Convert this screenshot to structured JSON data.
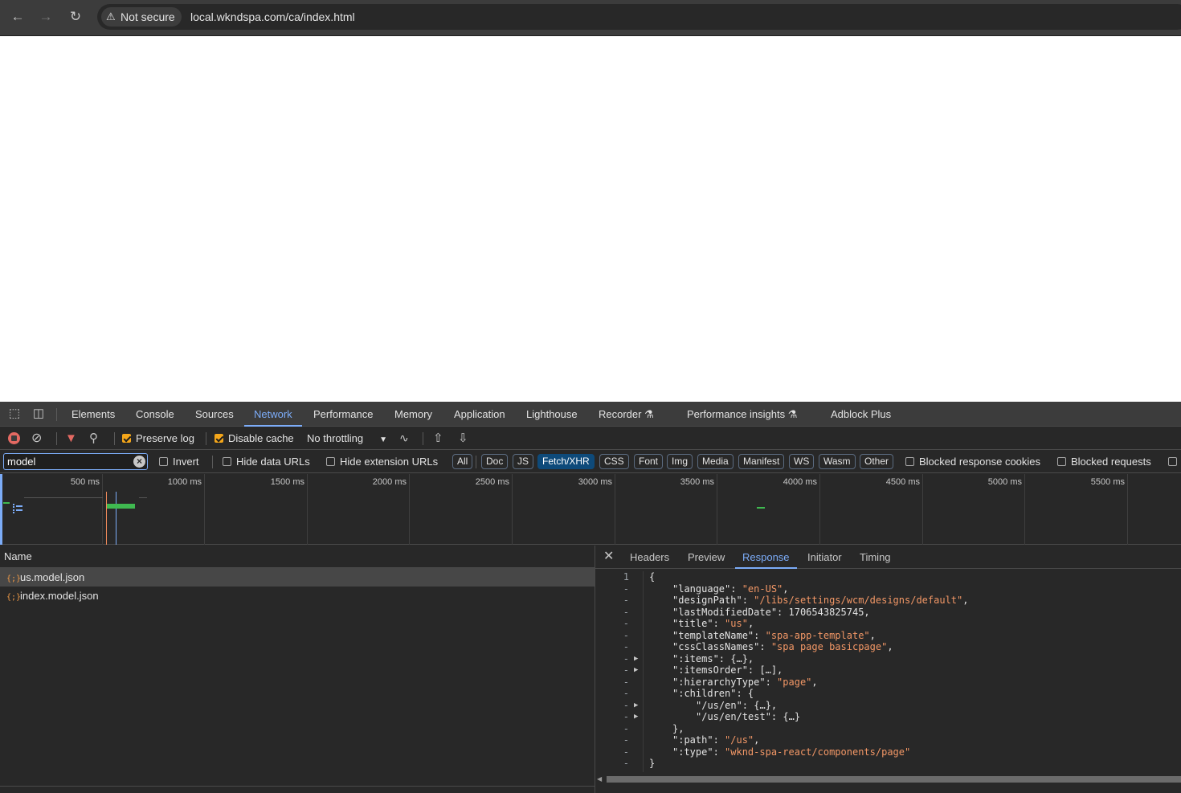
{
  "browser": {
    "back_icon": "arrow-left-icon",
    "forward_icon": "arrow-right-icon",
    "reload_icon": "reload-icon",
    "security_label": "Not secure",
    "url": "local.wkndspa.com/ca/index.html"
  },
  "devtools": {
    "tabs": [
      "Elements",
      "Console",
      "Sources",
      "Network",
      "Performance",
      "Memory",
      "Application",
      "Lighthouse",
      "Recorder",
      "Performance insights",
      "Adblock Plus"
    ],
    "active_tab": "Network",
    "toolbar": {
      "preserve_log": "Preserve log",
      "preserve_log_checked": true,
      "disable_cache": "Disable cache",
      "disable_cache_checked": true,
      "throttling": "No throttling"
    },
    "filter": {
      "value": "model",
      "invert": "Invert",
      "hide_data_urls": "Hide data URLs",
      "hide_extension_urls": "Hide extension URLs",
      "types": [
        "All",
        "Doc",
        "JS",
        "Fetch/XHR",
        "CSS",
        "Font",
        "Img",
        "Media",
        "Manifest",
        "WS",
        "Wasm",
        "Other"
      ],
      "active_type": "Fetch/XHR",
      "blocked_cookies": "Blocked response cookies",
      "blocked_requests": "Blocked requests"
    },
    "timeline": {
      "ticks": [
        "500 ms",
        "1000 ms",
        "1500 ms",
        "2000 ms",
        "2500 ms",
        "3000 ms",
        "3500 ms",
        "4000 ms",
        "4500 ms",
        "5000 ms",
        "5500 ms"
      ]
    },
    "requests": {
      "column_name": "Name",
      "items": [
        "us.model.json",
        "index.model.json"
      ],
      "selected": "us.model.json"
    },
    "details": {
      "tabs": [
        "Headers",
        "Preview",
        "Response",
        "Initiator",
        "Timing"
      ],
      "active_tab": "Response",
      "lines": [
        {
          "no": "1",
          "arrow": false,
          "indent": 0,
          "tokens": [
            [
              "p",
              "{"
            ]
          ]
        },
        {
          "no": "-",
          "arrow": false,
          "indent": 1,
          "tokens": [
            [
              "k",
              "\"language\""
            ],
            [
              "p",
              ": "
            ],
            [
              "s",
              "\"en-US\""
            ],
            [
              "p",
              ","
            ]
          ]
        },
        {
          "no": "-",
          "arrow": false,
          "indent": 1,
          "tokens": [
            [
              "k",
              "\"designPath\""
            ],
            [
              "p",
              ": "
            ],
            [
              "s",
              "\"/libs/settings/wcm/designs/default\""
            ],
            [
              "p",
              ","
            ]
          ]
        },
        {
          "no": "-",
          "arrow": false,
          "indent": 1,
          "tokens": [
            [
              "k",
              "\"lastModifiedDate\""
            ],
            [
              "p",
              ": "
            ],
            [
              "n",
              "1706543825745"
            ],
            [
              "p",
              ","
            ]
          ]
        },
        {
          "no": "-",
          "arrow": false,
          "indent": 1,
          "tokens": [
            [
              "k",
              "\"title\""
            ],
            [
              "p",
              ": "
            ],
            [
              "s",
              "\"us\""
            ],
            [
              "p",
              ","
            ]
          ]
        },
        {
          "no": "-",
          "arrow": false,
          "indent": 1,
          "tokens": [
            [
              "k",
              "\"templateName\""
            ],
            [
              "p",
              ": "
            ],
            [
              "s",
              "\"spa-app-template\""
            ],
            [
              "p",
              ","
            ]
          ]
        },
        {
          "no": "-",
          "arrow": false,
          "indent": 1,
          "tokens": [
            [
              "k",
              "\"cssClassNames\""
            ],
            [
              "p",
              ": "
            ],
            [
              "s",
              "\"spa page basicpage\""
            ],
            [
              "p",
              ","
            ]
          ]
        },
        {
          "no": "-",
          "arrow": true,
          "indent": 1,
          "tokens": [
            [
              "k",
              "\":items\""
            ],
            [
              "p",
              ": {…},"
            ]
          ]
        },
        {
          "no": "-",
          "arrow": true,
          "indent": 1,
          "tokens": [
            [
              "k",
              "\":itemsOrder\""
            ],
            [
              "p",
              ": […],"
            ]
          ]
        },
        {
          "no": "-",
          "arrow": false,
          "indent": 1,
          "tokens": [
            [
              "k",
              "\":hierarchyType\""
            ],
            [
              "p",
              ": "
            ],
            [
              "s",
              "\"page\""
            ],
            [
              "p",
              ","
            ]
          ]
        },
        {
          "no": "-",
          "arrow": false,
          "indent": 1,
          "tokens": [
            [
              "k",
              "\":children\""
            ],
            [
              "p",
              ": {"
            ]
          ]
        },
        {
          "no": "-",
          "arrow": true,
          "indent": 2,
          "tokens": [
            [
              "k",
              "\"/us/en\""
            ],
            [
              "p",
              ": {…},"
            ]
          ]
        },
        {
          "no": "-",
          "arrow": true,
          "indent": 2,
          "tokens": [
            [
              "k",
              "\"/us/en/test\""
            ],
            [
              "p",
              ": {…}"
            ]
          ]
        },
        {
          "no": "-",
          "arrow": false,
          "indent": 1,
          "tokens": [
            [
              "p",
              "},"
            ]
          ]
        },
        {
          "no": "-",
          "arrow": false,
          "indent": 1,
          "tokens": [
            [
              "k",
              "\":path\""
            ],
            [
              "p",
              ": "
            ],
            [
              "s",
              "\"/us\""
            ],
            [
              "p",
              ","
            ]
          ]
        },
        {
          "no": "-",
          "arrow": false,
          "indent": 1,
          "tokens": [
            [
              "k",
              "\":type\""
            ],
            [
              "p",
              ": "
            ],
            [
              "s",
              "\"wknd-spa-react/components/page\""
            ]
          ]
        },
        {
          "no": "-",
          "arrow": false,
          "indent": 0,
          "tokens": [
            [
              "p",
              "}"
            ]
          ]
        }
      ]
    }
  }
}
